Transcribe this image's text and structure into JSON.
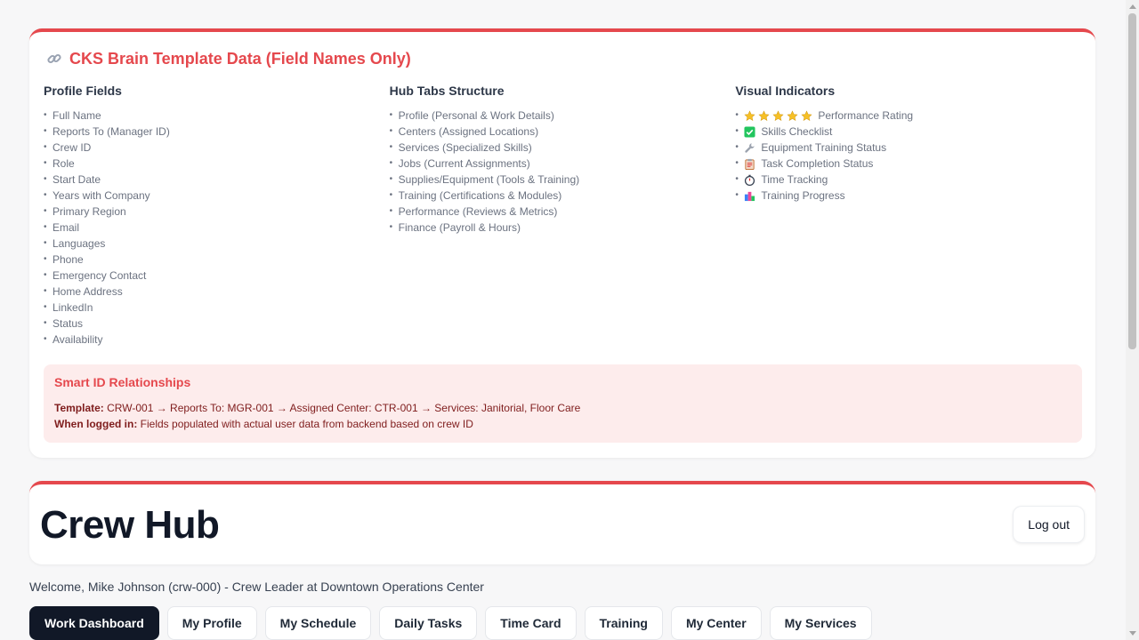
{
  "template": {
    "title": "CKS Brain Template Data (Field Names Only)",
    "profile_fields": {
      "heading": "Profile Fields",
      "items": [
        "Full Name",
        "Reports To (Manager ID)",
        "Crew ID",
        "Role",
        "Start Date",
        "Years with Company",
        "Primary Region",
        "Email",
        "Languages",
        "Phone",
        "Emergency Contact",
        "Home Address",
        "LinkedIn",
        "Status",
        "Availability"
      ]
    },
    "hub_tabs": {
      "heading": "Hub Tabs Structure",
      "items": [
        "Profile (Personal & Work Details)",
        "Centers (Assigned Locations)",
        "Services (Specialized Skills)",
        "Jobs (Current Assignments)",
        "Supplies/Equipment (Tools & Training)",
        "Training (Certifications & Modules)",
        "Performance (Reviews & Metrics)",
        "Finance (Payroll & Hours)"
      ]
    },
    "visual_indicators": {
      "heading": "Visual Indicators",
      "items": [
        {
          "icon": "star-icon",
          "label": "Performance Rating"
        },
        {
          "icon": "check-box-icon",
          "label": "Skills Checklist"
        },
        {
          "icon": "wrench-icon",
          "label": "Equipment Training Status"
        },
        {
          "icon": "clipboard-icon",
          "label": "Task Completion Status"
        },
        {
          "icon": "stopwatch-icon",
          "label": "Time Tracking"
        },
        {
          "icon": "bar-chart-icon",
          "label": "Training Progress"
        }
      ],
      "rating_stars": 5
    },
    "smart_id": {
      "heading": "Smart ID Relationships",
      "template_label": "Template:",
      "template_text": "CRW-001 → Reports To: MGR-001 → Assigned Center: CTR-001 → Services: Janitorial, Floor Care",
      "logged_in_label": "When logged in:",
      "logged_in_text": "Fields populated with actual user data from backend based on crew ID"
    }
  },
  "hub": {
    "title": "Crew Hub",
    "logout_label": "Log out",
    "welcome": "Welcome, Mike Johnson (crw-000) - Crew Leader at Downtown Operations Center",
    "tabs": [
      "Work Dashboard",
      "My Profile",
      "My Schedule",
      "Daily Tasks",
      "Time Card",
      "Training",
      "My Center",
      "My Services"
    ],
    "active_tab": "Work Dashboard"
  },
  "colors": {
    "accent": "#e5484d",
    "smart_box_bg": "#fdecec",
    "active_tab_bg": "#111827"
  }
}
